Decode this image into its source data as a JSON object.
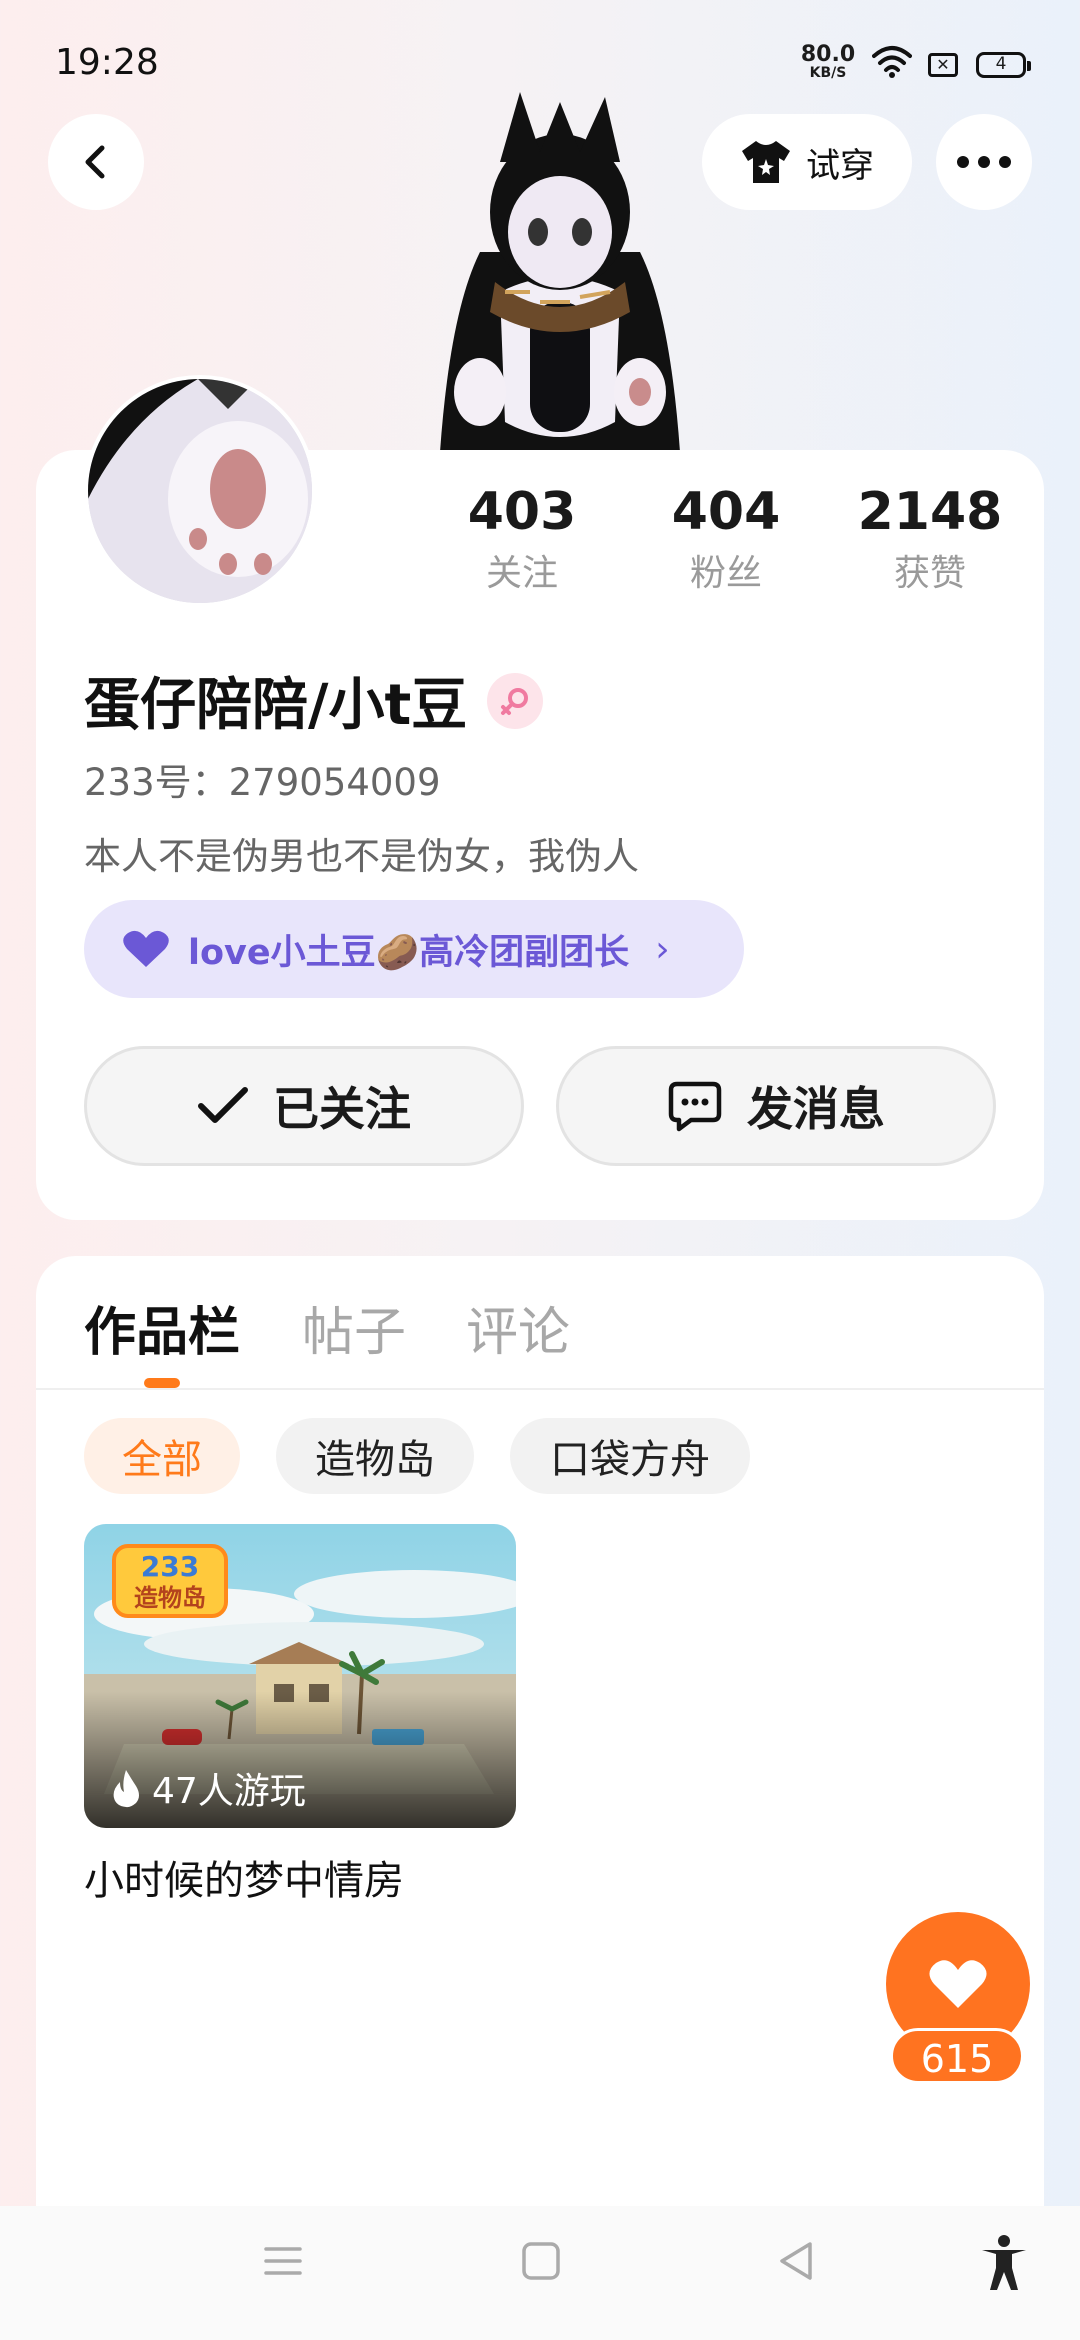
{
  "status_bar": {
    "time": "19:28",
    "net_speed_value": "80.0",
    "net_speed_unit": "KB/S",
    "battery": "4"
  },
  "top_bar": {
    "tryon_label": "试穿"
  },
  "profile": {
    "stats": [
      {
        "value": "403",
        "label": "关注"
      },
      {
        "value": "404",
        "label": "粉丝"
      },
      {
        "value": "2148",
        "label": "获赞"
      }
    ],
    "nickname": "蛋仔陪陪/小t豆",
    "uid": "233号：279054009",
    "bio": "本人不是伪男也不是伪女，我伪人",
    "group_tag": "love小土豆🥔高冷团副团长",
    "follow_label": "已关注",
    "message_label": "发消息"
  },
  "tabs": [
    "作品栏",
    "帖子",
    "评论"
  ],
  "chips": [
    "全部",
    "造物岛",
    "口袋方舟"
  ],
  "work": {
    "plays": "47人游玩",
    "title": "小时候的梦中情房",
    "thumb_logo_top": "233",
    "thumb_logo_bottom": "造物岛"
  },
  "like": {
    "count": "615"
  },
  "colors": {
    "accent": "#ff7320",
    "group_purple": "#6b58d6",
    "tab_indicator": "#ff7a1a"
  },
  "icons": [
    "back-icon",
    "shirt-icon",
    "more-icon",
    "gender-icon",
    "heart-purple-icon",
    "check-icon",
    "chat-icon",
    "fire-icon",
    "heart-icon",
    "menu-icon",
    "home-icon",
    "nav-back-icon",
    "accessibility-icon"
  ]
}
